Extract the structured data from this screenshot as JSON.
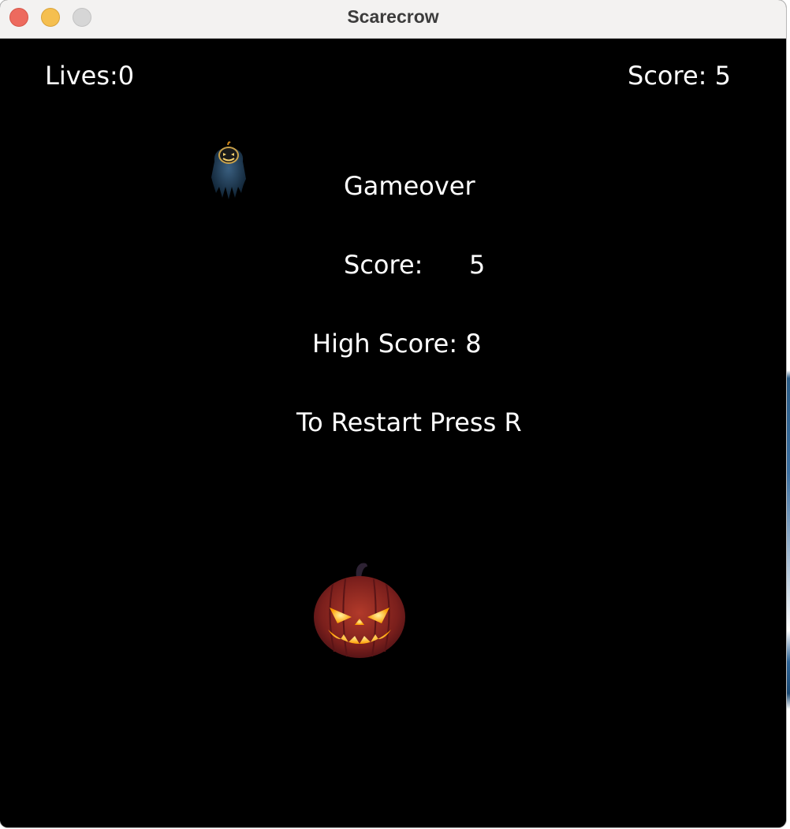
{
  "window": {
    "title": "Scarecrow"
  },
  "hud": {
    "lives_label": "Lives:",
    "lives_value": "0",
    "score_label": "Score:",
    "score_value": "5"
  },
  "gameover": {
    "title": "Gameover",
    "score_label": "Score:",
    "score_value": "5",
    "high_score_label": "High Score:",
    "high_score_value": "8",
    "restart_hint": "To Restart Press R"
  },
  "sprites": {
    "ghost": "ghost-scarecrow-icon",
    "pumpkin": "jack-o-lantern-icon"
  },
  "colors": {
    "background": "#000000",
    "text": "#ffffff",
    "pumpkin_orange": "#c0392b",
    "pumpkin_glow": "#ffb400",
    "ghost_blue": "#2c4a63"
  }
}
